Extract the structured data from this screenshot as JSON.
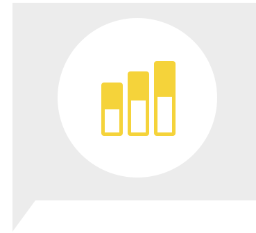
{
  "icon": {
    "name": "bar-chart-icon",
    "bars": [
      {
        "level": 0.5
      },
      {
        "level": 0.55
      },
      {
        "level": 0.52
      }
    ]
  },
  "colors": {
    "bubble_background": "#ececec",
    "circle": "#ffffff",
    "bar_accent": "#f5d33a"
  }
}
